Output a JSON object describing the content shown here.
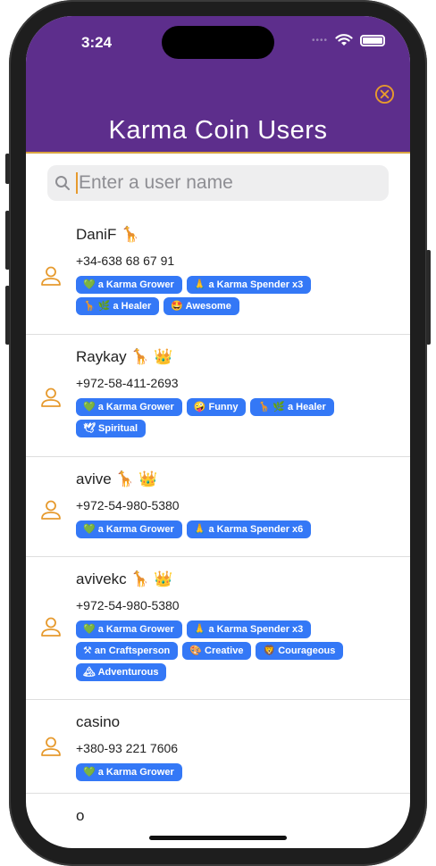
{
  "status": {
    "time": "3:24"
  },
  "header": {
    "title": "Karma Coin Users"
  },
  "search": {
    "placeholder": "Enter a user name"
  },
  "users": [
    {
      "name": "DaniF 🦒",
      "phone": "+34-638 68 67 91",
      "badges": [
        "💚 a Karma Grower",
        "🙏 a Karma Spender x3",
        "🦒 🌿 a Healer",
        "🤩 Awesome"
      ]
    },
    {
      "name": "Raykay 🦒 👑",
      "phone": "+972-58-411-2693",
      "badges": [
        "💚 a Karma Grower",
        "🤪 Funny",
        "🦒 🌿 a Healer",
        "🕊 Spiritual"
      ]
    },
    {
      "name": "avive 🦒 👑",
      "phone": "+972-54-980-5380",
      "badges": [
        "💚 a Karma Grower",
        "🙏 a Karma Spender x6"
      ]
    },
    {
      "name": "avivekc 🦒 👑",
      "phone": "+972-54-980-5380",
      "badges": [
        "💚 a Karma Grower",
        "🙏 a Karma Spender x3",
        "⚒ an Craftsperson",
        "🎨 Creative",
        "🦁 Courageous",
        "🏔 Adventurous"
      ]
    },
    {
      "name": "casino",
      "phone": "+380-93 221 7606",
      "badges": [
        "💚 a Karma Grower"
      ]
    },
    {
      "name": "o",
      "phone": "",
      "badges": []
    }
  ],
  "colors": {
    "header": "#5d2e8c",
    "accent": "#e69a2e",
    "badge": "#3478f6"
  },
  "icons": {
    "close": "close-circle-icon",
    "avatar": "person-icon",
    "search": "search-icon"
  }
}
